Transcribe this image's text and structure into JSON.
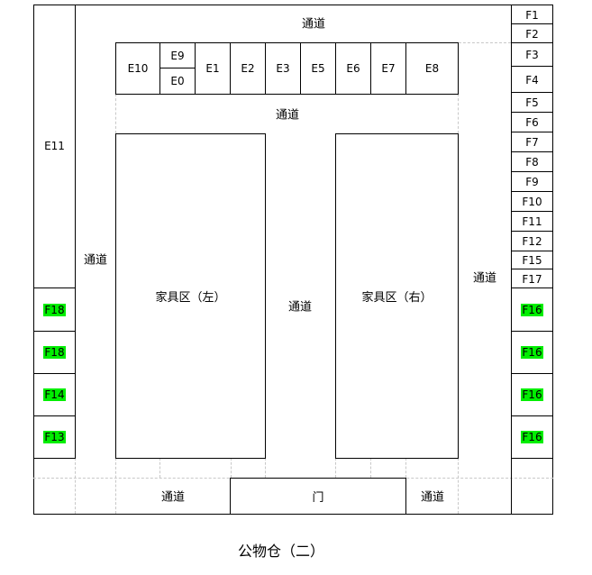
{
  "diagram": {
    "title": "公物仓（二）",
    "aisle_label": "通道",
    "door_label": "门",
    "zones": {
      "left": "家具区（左）",
      "right": "家具区（右）"
    },
    "e_cells": {
      "e10": "E10",
      "e9": "E9",
      "e0": "E0",
      "e1": "E1",
      "e2": "E2",
      "e3": "E3",
      "e5": "E5",
      "e6": "E6",
      "e7": "E7",
      "e8": "E8",
      "e11": "E11"
    },
    "left_green_cells": [
      "F18",
      "F18",
      "F14",
      "F13"
    ],
    "right_f_cells": [
      "F1",
      "F2",
      "F3",
      "F4",
      "F5",
      "F6",
      "F7",
      "F8",
      "F9",
      "F10",
      "F11",
      "F12",
      "F15",
      "F17"
    ],
    "right_green_cells": [
      "F16",
      "F16",
      "F16",
      "F16"
    ],
    "colors": {
      "highlight": "#00ee00",
      "line": "#000000",
      "guide": "#c8c8c8"
    }
  }
}
